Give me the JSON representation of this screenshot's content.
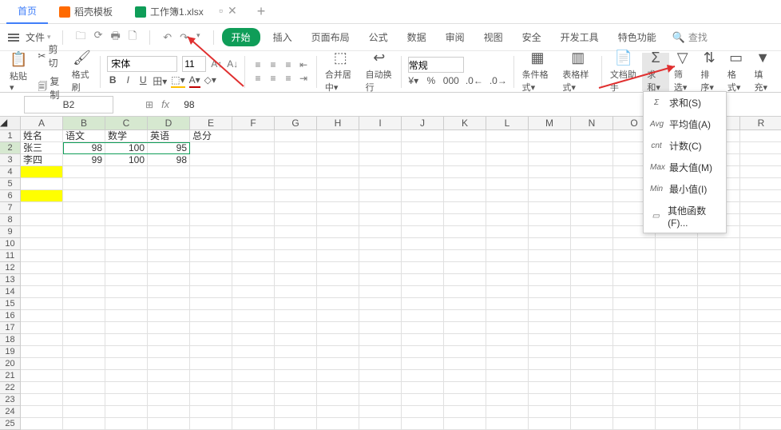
{
  "tabs": {
    "home": "首页",
    "template": "稻壳模板",
    "workbook": "工作簿1.xlsx"
  },
  "file_label": "文件",
  "menu": {
    "start": "开始",
    "insert": "插入",
    "layout": "页面布局",
    "formula": "公式",
    "data": "数据",
    "review": "审阅",
    "view": "视图",
    "security": "安全",
    "dev": "开发工具",
    "special": "特色功能",
    "search": "查找"
  },
  "ribbon": {
    "paste": "粘贴",
    "cut": "剪切",
    "copy": "复制",
    "fmtpaint": "格式刷",
    "font": "宋体",
    "fontsize": "11",
    "merge": "合并居中",
    "wrap": "自动换行",
    "numfmt": "常规",
    "condfmt": "条件格式",
    "tablestyle": "表格样式",
    "dochelp": "文档助手",
    "sum": "求和",
    "filter": "筛选",
    "sort": "排序",
    "format": "格式",
    "fill": "填充"
  },
  "dropdown": {
    "sum": "求和(S)",
    "avg": "平均值(A)",
    "count": "计数(C)",
    "max": "最大值(M)",
    "min": "最小值(I)",
    "other": "其他函数(F)..."
  },
  "namebox": "B2",
  "fxval": "98",
  "headers": {
    "A": "姓名",
    "B": "语文",
    "C": "数学",
    "D": "英语",
    "E": "总分"
  },
  "rows": [
    {
      "A": "张三",
      "B": "98",
      "C": "100",
      "D": "95"
    },
    {
      "A": "李四",
      "B": "99",
      "C": "100",
      "D": "98"
    }
  ],
  "cols": [
    "A",
    "B",
    "C",
    "D",
    "E",
    "F",
    "G",
    "H",
    "I",
    "J",
    "K",
    "L",
    "M",
    "N",
    "O",
    "P",
    "Q",
    "R"
  ],
  "chart_data": {
    "type": "table",
    "columns": [
      "姓名",
      "语文",
      "数学",
      "英语",
      "总分"
    ],
    "data": [
      [
        "张三",
        98,
        100,
        95,
        null
      ],
      [
        "李四",
        99,
        100,
        98,
        null
      ]
    ]
  }
}
